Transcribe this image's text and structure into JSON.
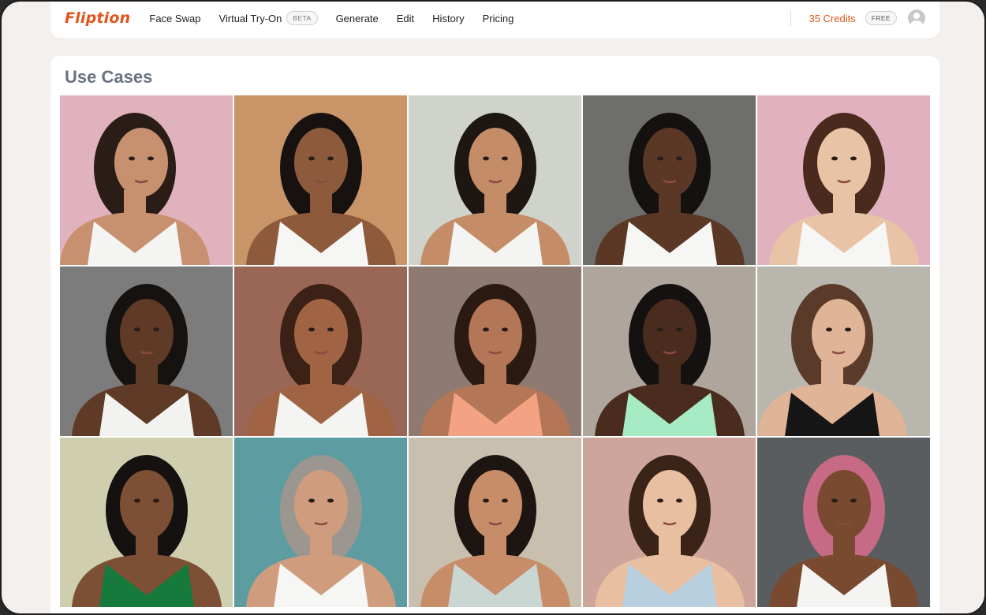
{
  "brand": "Fliption",
  "nav": [
    {
      "label": "Face Swap"
    },
    {
      "label": "Virtual Try-On",
      "badge": "BETA"
    },
    {
      "label": "Generate"
    },
    {
      "label": "Edit"
    },
    {
      "label": "History"
    },
    {
      "label": "Pricing"
    }
  ],
  "account": {
    "credits": "35 Credits",
    "plan": "FREE"
  },
  "section_title": "Use Cases",
  "colors": {
    "accent": "#e2541a",
    "title": "#6b7280"
  },
  "tiles": [
    {
      "bg": "#e0b2bd",
      "skin": "#c7906e",
      "hair": "#2a1c16",
      "top": "#f4f4f2",
      "pose": "profile"
    },
    {
      "bg": "#c89468",
      "skin": "#8d5a3b",
      "hair": "#171210",
      "top": "#f6f6f4",
      "pose": "front"
    },
    {
      "bg": "#cfd3cb",
      "skin": "#c48d68",
      "hair": "#1d1613",
      "top": "#f4f4f2",
      "pose": "front"
    },
    {
      "bg": "#6e6e6c",
      "skin": "#5b3826",
      "hair": "#141110",
      "top": "#f6f6f4",
      "pose": "front"
    },
    {
      "bg": "#e1b1c0",
      "skin": "#e9c3a6",
      "hair": "#4a2a1c",
      "top": "#f6f6f4",
      "pose": "front"
    },
    {
      "bg": "#7c7c7c",
      "skin": "#5e3a27",
      "hair": "#161210",
      "top": "#f2f2f0",
      "pose": "front"
    },
    {
      "bg": "#9a6656",
      "skin": "#a06444",
      "hair": "#3c2216",
      "top": "#f4f4f2",
      "pose": "front"
    },
    {
      "bg": "#8e7a70",
      "skin": "#b37656",
      "hair": "#2b1a12",
      "top": "#f3a283",
      "pose": "front"
    },
    {
      "bg": "#aea69d",
      "skin": "#4a2c1e",
      "hair": "#151110",
      "top": "#a6ebc3",
      "pose": "front"
    },
    {
      "bg": "#b9b6ae",
      "skin": "#dfb497",
      "hair": "#5a3a28",
      "top": "#161616",
      "pose": "profile"
    },
    {
      "bg": "#cfcfb0",
      "skin": "#7d4f34",
      "hair": "#151110",
      "top": "#157a3c",
      "pose": "front"
    },
    {
      "bg": "#5d9da2",
      "skin": "#cf9d7d",
      "hair": "#9c9690",
      "top": "#f6f6f4",
      "pose": "front"
    },
    {
      "bg": "#c9bfae",
      "skin": "#c78d69",
      "hair": "#1c1512",
      "top": "#c9d6d2",
      "pose": "front"
    },
    {
      "bg": "#cda59b",
      "skin": "#e8bfa0",
      "hair": "#3a2418",
      "top": "#b8cfe0",
      "pose": "front"
    },
    {
      "bg": "#595d5f",
      "skin": "#7a4a30",
      "hair": "#c66a85",
      "top": "#f4f4f2",
      "pose": "front"
    }
  ]
}
